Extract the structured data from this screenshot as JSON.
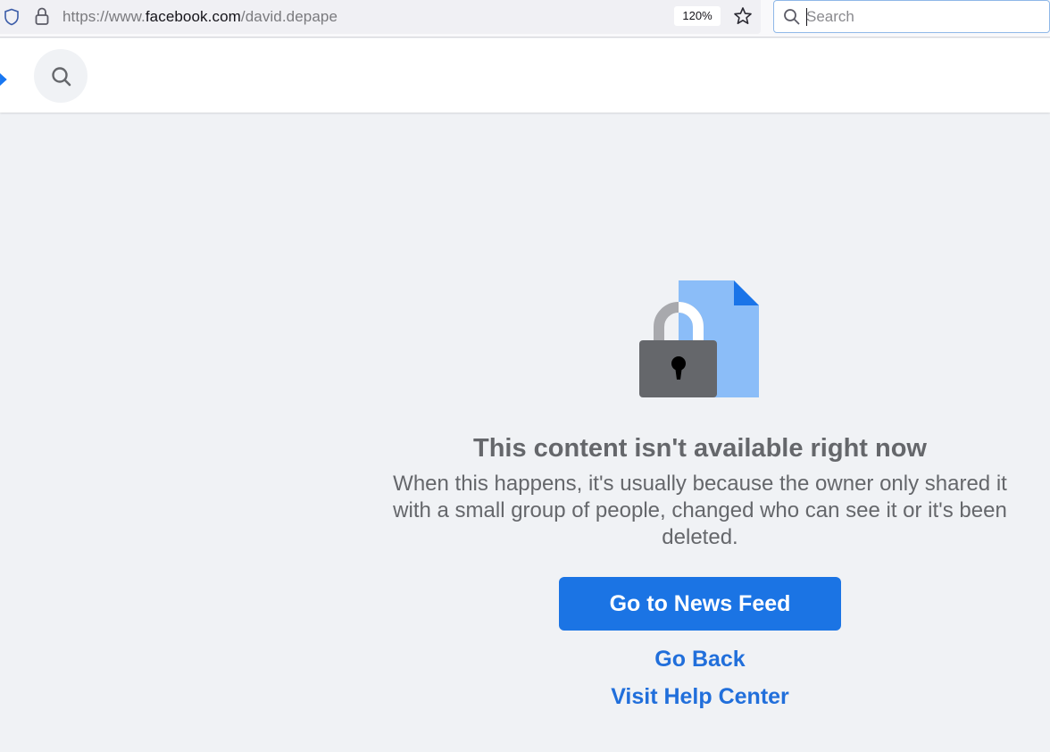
{
  "browser": {
    "url_prefix": "https://www.",
    "url_domain": "facebook.com",
    "url_path": "/david.depape",
    "zoom": "120%",
    "search_placeholder": "Search"
  },
  "icons": {
    "tracking": "shield-icon",
    "security": "lock-icon",
    "bookmark": "star-icon",
    "search": "search-icon",
    "logo": "facebook-logo",
    "content": "locked-document-icon"
  },
  "colors": {
    "accent": "#1b74e4",
    "link": "#216fdb",
    "text_secondary": "#65676b",
    "page_background": "#f0f2f5"
  },
  "main": {
    "title": "This content isn't available right now",
    "description": "When this happens, it's usually because the owner only shared it with a small group of people, changed who can see it or it's been deleted.",
    "primary_button": "Go to News Feed",
    "back_link": "Go Back",
    "help_link": "Visit Help Center"
  }
}
